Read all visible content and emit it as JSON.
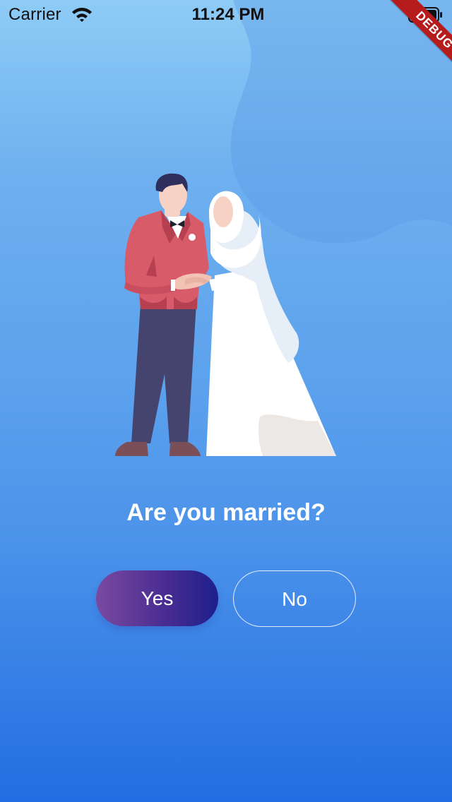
{
  "status_bar": {
    "carrier": "Carrier",
    "time": "11:24 PM",
    "wifi_icon": "wifi-icon",
    "battery_icon": "battery-icon"
  },
  "debug_banner": {
    "label": "DEBUG",
    "color": "#b71c1c"
  },
  "illustration": {
    "icon": "married-couple-illustration"
  },
  "question": {
    "text": "Are you married?"
  },
  "answers": {
    "yes_label": "Yes",
    "no_label": "No"
  },
  "colors": {
    "background_top": "#8ecbf6",
    "background_bottom": "#226ee2",
    "yes_button_start": "#7a4aa0",
    "yes_button_end": "#1d1f8c",
    "text": "#ffffff"
  }
}
